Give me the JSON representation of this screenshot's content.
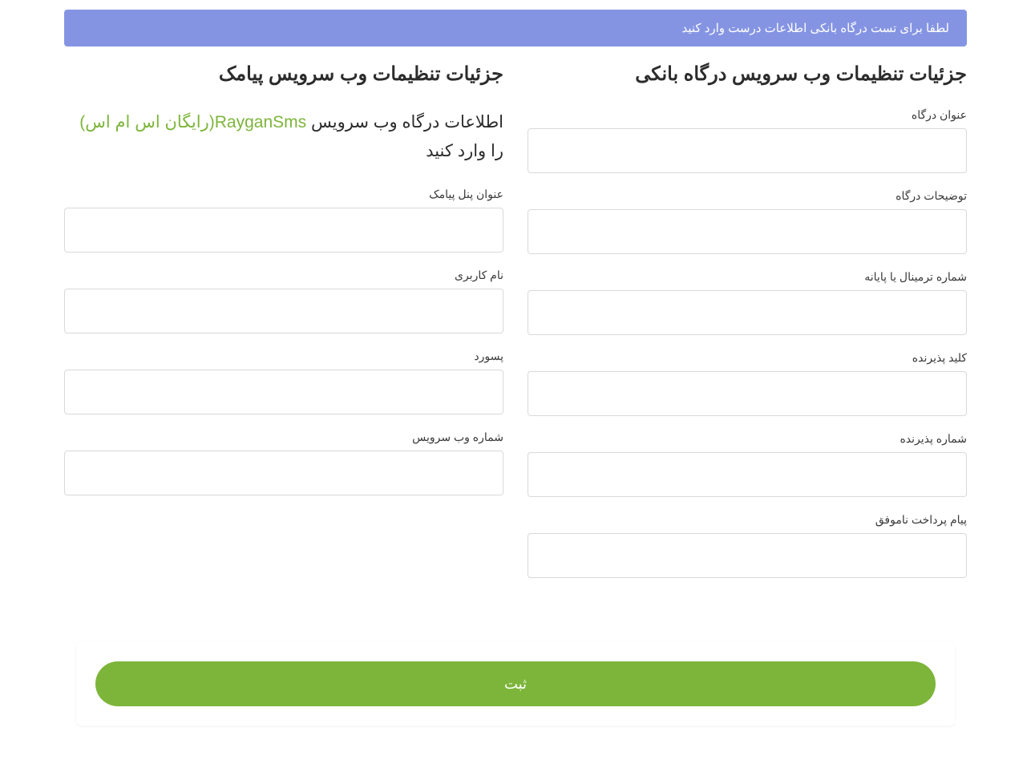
{
  "alert": {
    "message": "لطفا برای تست درگاه بانکی اطلاعات درست وارد کنید"
  },
  "bank": {
    "heading": "جزئیات تنظیمات وب سرویس درگاه بانکی",
    "fields": {
      "title": {
        "label": "عنوان درگاه",
        "value": ""
      },
      "description": {
        "label": "توضیحات درگاه",
        "value": ""
      },
      "terminal": {
        "label": "شماره ترمینال یا پایانه",
        "value": ""
      },
      "acceptor_key": {
        "label": "کلید پذیرنده",
        "value": ""
      },
      "acceptor_number": {
        "label": "شماره پذیرنده",
        "value": ""
      },
      "fail_message": {
        "label": "پیام پرداخت ناموفق",
        "value": ""
      }
    }
  },
  "sms": {
    "heading": "جزئیات تنظیمات وب سرویس پیامک",
    "subheading_prefix": "اطلاعات درگاه وب سرویس ",
    "brand_latin": "RayganSms",
    "brand_fa": "(رایگان اس ام اس)",
    "subheading_suffix": " را وارد کنید",
    "fields": {
      "panel_title": {
        "label": "عنوان پنل پیامک",
        "value": ""
      },
      "username": {
        "label": "نام کاربری",
        "value": ""
      },
      "password": {
        "label": "پسورد",
        "value": ""
      },
      "service_number": {
        "label": "شماره وب سرویس",
        "value": ""
      }
    }
  },
  "submit": {
    "label": "ثبت"
  }
}
